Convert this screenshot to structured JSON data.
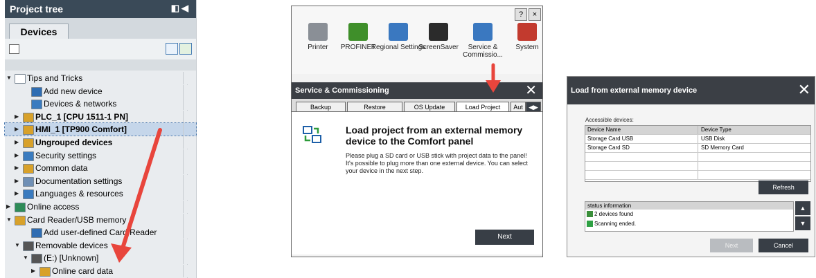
{
  "tree": {
    "title": "Project tree",
    "tab": "Devices",
    "items": [
      {
        "label": "Tips and Tricks",
        "indent": 1,
        "exp": "▼",
        "bold": false,
        "icon": "folder-icon",
        "color": "#ffffff"
      },
      {
        "label": "Add new device",
        "indent": 3,
        "exp": "",
        "bold": false,
        "icon": "add-device-icon",
        "color": "#2f6db2"
      },
      {
        "label": "Devices & networks",
        "indent": 3,
        "exp": "",
        "bold": false,
        "icon": "network-icon",
        "color": "#3a7bbf"
      },
      {
        "label": "PLC_1 [CPU 1511-1 PN]",
        "indent": 2,
        "exp": "▶",
        "bold": true,
        "icon": "plc-icon",
        "color": "#d8a12a"
      },
      {
        "label": "HMI_1 [TP900 Comfort]",
        "indent": 2,
        "exp": "▶",
        "bold": true,
        "icon": "hmi-icon",
        "color": "#d8a12a",
        "selected": true
      },
      {
        "label": "Ungrouped devices",
        "indent": 2,
        "exp": "▶",
        "bold": true,
        "icon": "ungrouped-icon",
        "color": "#d8a12a"
      },
      {
        "label": "Security settings",
        "indent": 2,
        "exp": "▶",
        "bold": false,
        "icon": "security-icon",
        "color": "#3a7bbf"
      },
      {
        "label": "Common data",
        "indent": 2,
        "exp": "▶",
        "bold": false,
        "icon": "common-data-icon",
        "color": "#d8a12a"
      },
      {
        "label": "Documentation settings",
        "indent": 2,
        "exp": "▶",
        "bold": false,
        "icon": "documentation-icon",
        "color": "#6f8fb5"
      },
      {
        "label": "Languages & resources",
        "indent": 2,
        "exp": "▶",
        "bold": false,
        "icon": "languages-icon",
        "color": "#3a7bbf"
      },
      {
        "label": "Online access",
        "indent": 1,
        "exp": "▶",
        "bold": false,
        "icon": "online-access-icon",
        "color": "#2e8b57"
      },
      {
        "label": "Card Reader/USB memory",
        "indent": 1,
        "exp": "▼",
        "bold": false,
        "icon": "card-reader-icon",
        "color": "#d8a12a"
      },
      {
        "label": "Add user-defined Card Reader",
        "indent": 3,
        "exp": "",
        "bold": false,
        "icon": "add-card-reader-icon",
        "color": "#2f6db2"
      },
      {
        "label": "Removable devices",
        "indent": 2,
        "exp": "▼",
        "bold": false,
        "icon": "removable-device-icon",
        "color": "#555555"
      },
      {
        "label": "(E:) [Unknown]",
        "indent": 3,
        "exp": "▼",
        "bold": false,
        "icon": "drive-icon",
        "color": "#555555"
      },
      {
        "label": "Online card data",
        "indent": 4,
        "exp": "▶",
        "bold": false,
        "icon": "card-data-icon",
        "color": "#d8a12a"
      }
    ]
  },
  "panel": {
    "icons": [
      {
        "label": "Printer",
        "name": "printer-icon",
        "color": "#8a8f96"
      },
      {
        "label": "PROFINET",
        "name": "profinet-icon",
        "color": "#3f8f2a"
      },
      {
        "label": "Regional Settings",
        "name": "regional-settings-icon",
        "color": "#3a78c0"
      },
      {
        "label": "ScreenSaver",
        "name": "screensaver-icon",
        "color": "#2b2b2b"
      },
      {
        "label": "Service & Commissio...",
        "name": "service-commissioning-icon",
        "color": "#3a78c0"
      },
      {
        "label": "System",
        "name": "system-icon",
        "color": "#c23a2e"
      }
    ],
    "dialog_title": "Service & Commissioning",
    "tabs": [
      "Backup",
      "Restore",
      "OS Update",
      "Load Project",
      "Aut"
    ],
    "heading": "Load project from an external memory device to the Comfort panel",
    "message": "Please plug a SD card or USB stick with project data to the panel! It's possible to plug more than one external device. You can select your device in the next step.",
    "next_label": "Next"
  },
  "dialog": {
    "title": "Load from external memory device",
    "caption": "Accessible devices:",
    "columns": [
      "Device Name",
      "Device Type"
    ],
    "rows": [
      [
        "Storage Card USB",
        "USB Disk"
      ],
      [
        "Storage Card SD",
        "SD Memory Card"
      ],
      [
        "",
        ""
      ],
      [
        "",
        ""
      ],
      [
        "",
        ""
      ]
    ],
    "refresh_label": "Refresh",
    "status_header": "status information",
    "status": [
      "2 devices found",
      "Scanning ended."
    ],
    "next_label": "Next",
    "cancel_label": "Cancel"
  },
  "colors": {
    "arrow": "#e8453c"
  }
}
